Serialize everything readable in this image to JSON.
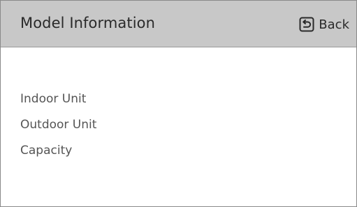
{
  "header": {
    "title": "Model Information",
    "back_label": "Back",
    "back_icon": "return-arrow-icon"
  },
  "fields": [
    {
      "label": "Indoor Unit"
    },
    {
      "label": "Outdoor Unit"
    },
    {
      "label": "Capacity"
    }
  ],
  "colors": {
    "header_background": "#c8c8c8",
    "text": "#2a2a2a",
    "field_text": "#555555",
    "background": "#ffffff"
  }
}
